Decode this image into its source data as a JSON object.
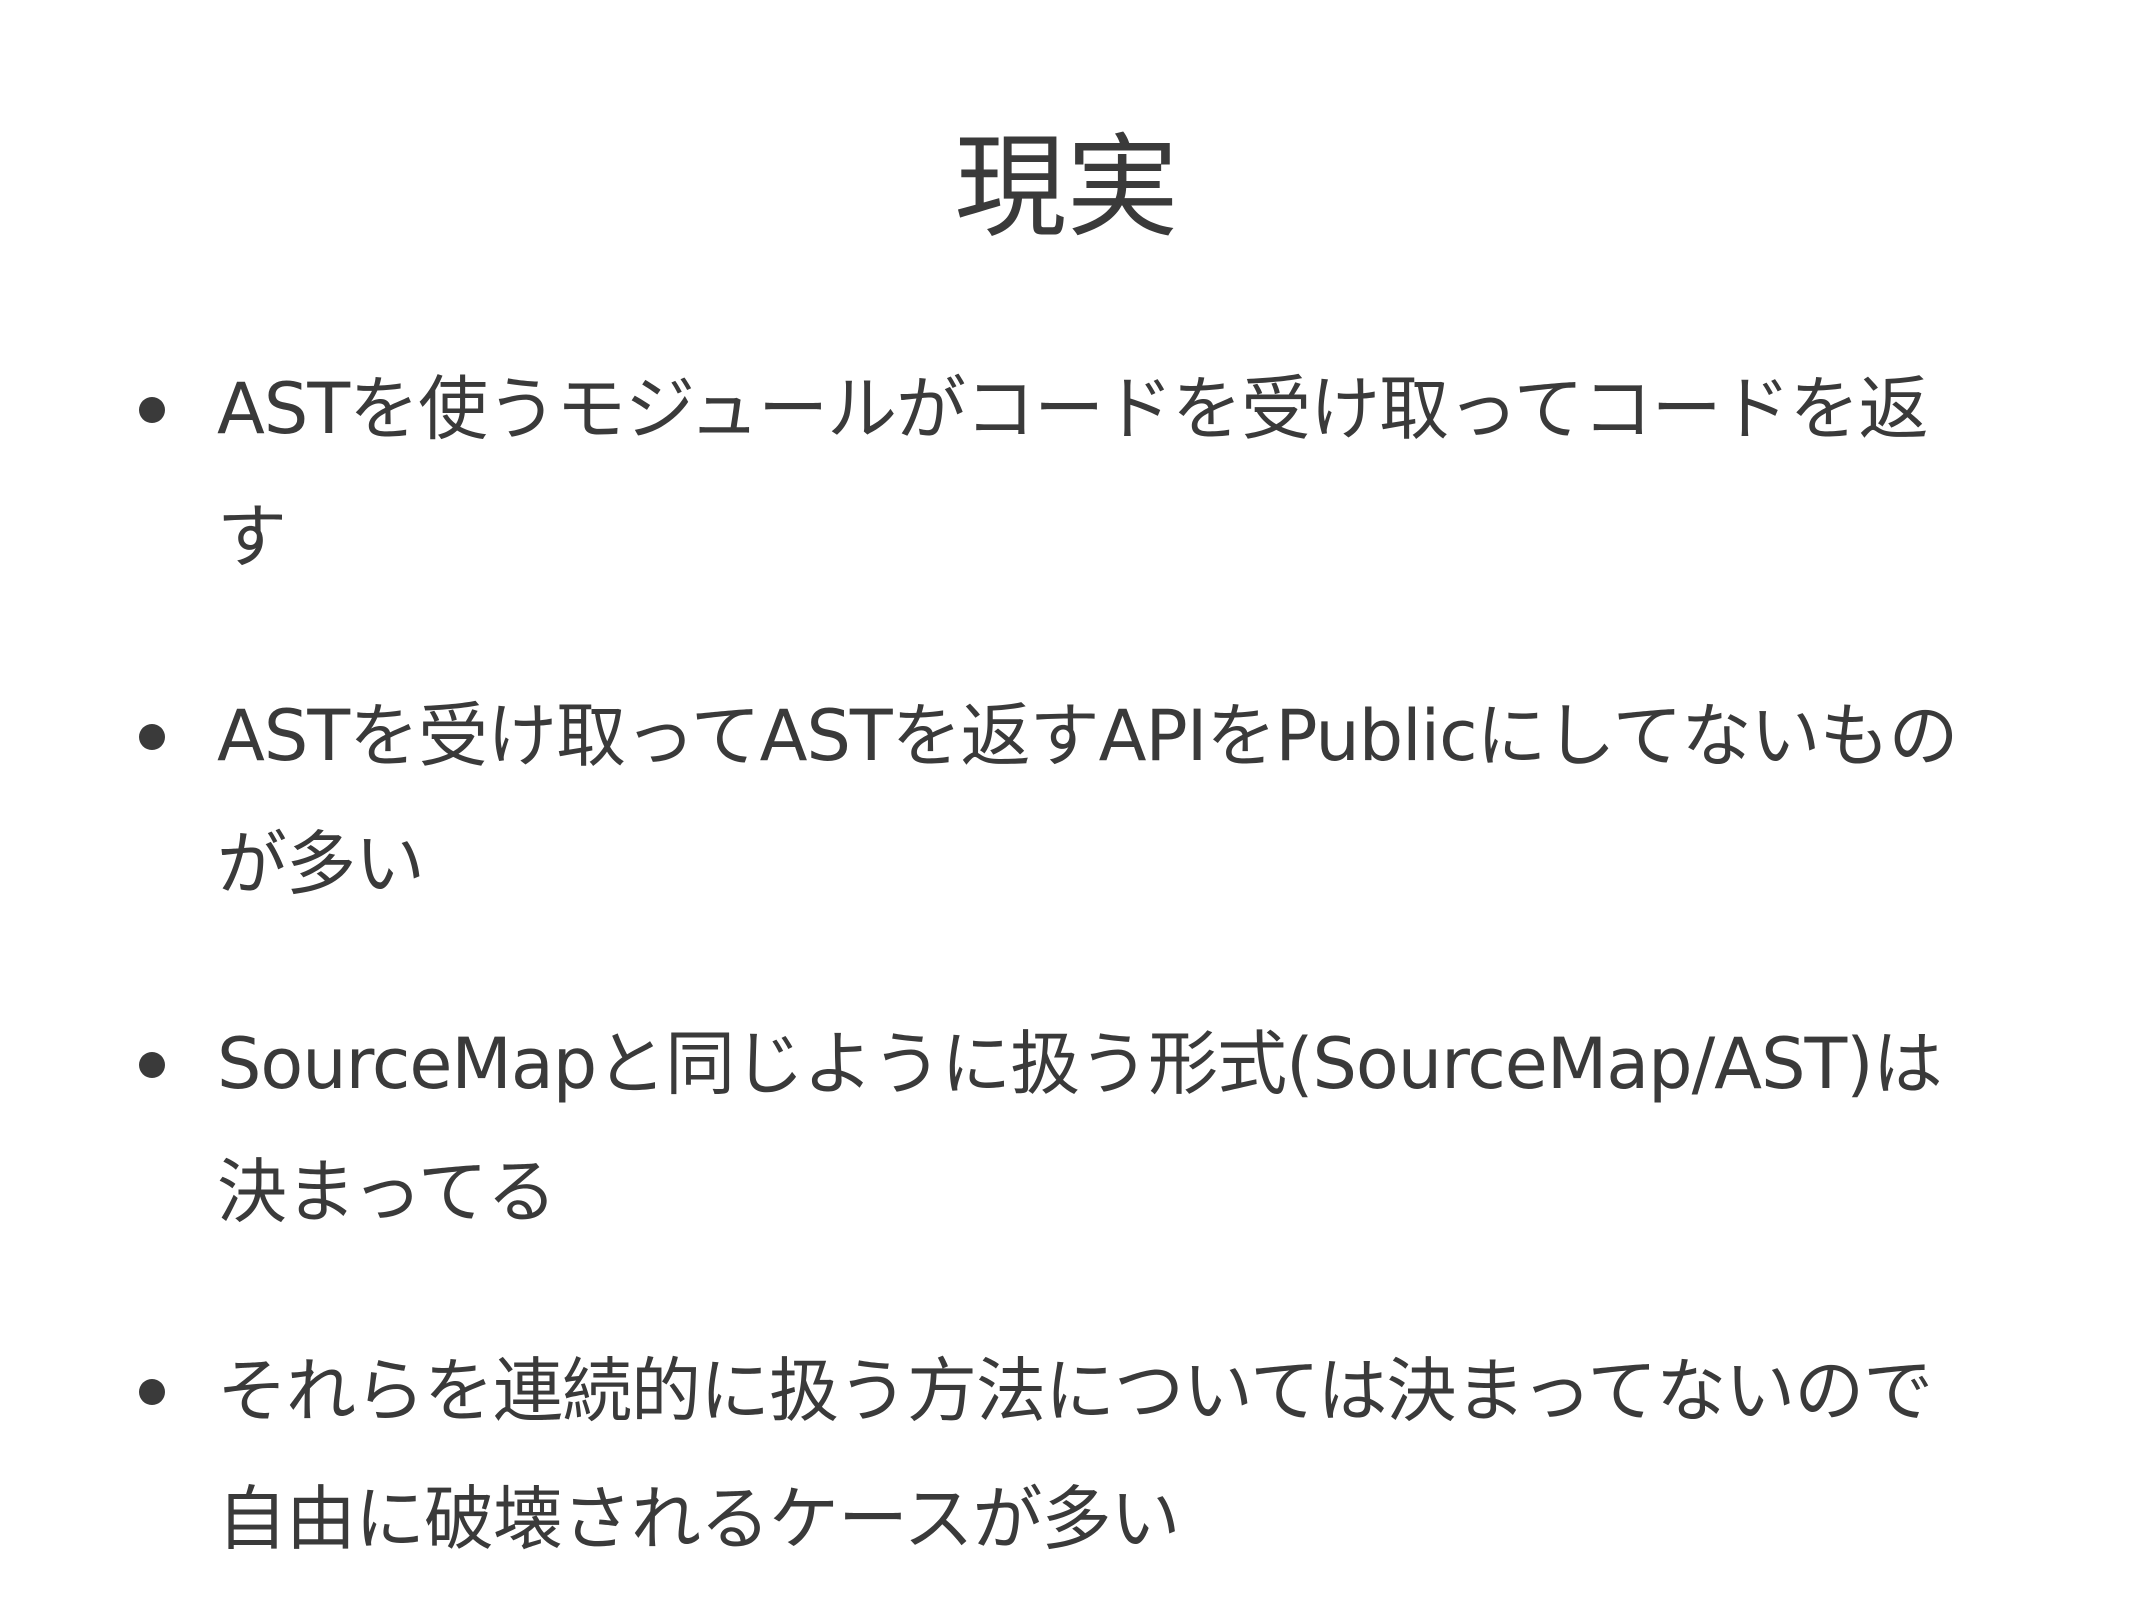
{
  "slide": {
    "title": "現実",
    "bullets": [
      {
        "text": "ASTを使うモジュールがコードを受け取ってコードを返す"
      },
      {
        "text": "ASTを受け取ってASTを返すAPIをPublicにしてないものが多い"
      },
      {
        "text": "SourceMapと同じように扱う形式(SourceMap/AST)は決まってる"
      },
      {
        "text": "それらを連続的に扱う方法については決まってないので自由に破壊されるケースが多い"
      }
    ]
  }
}
